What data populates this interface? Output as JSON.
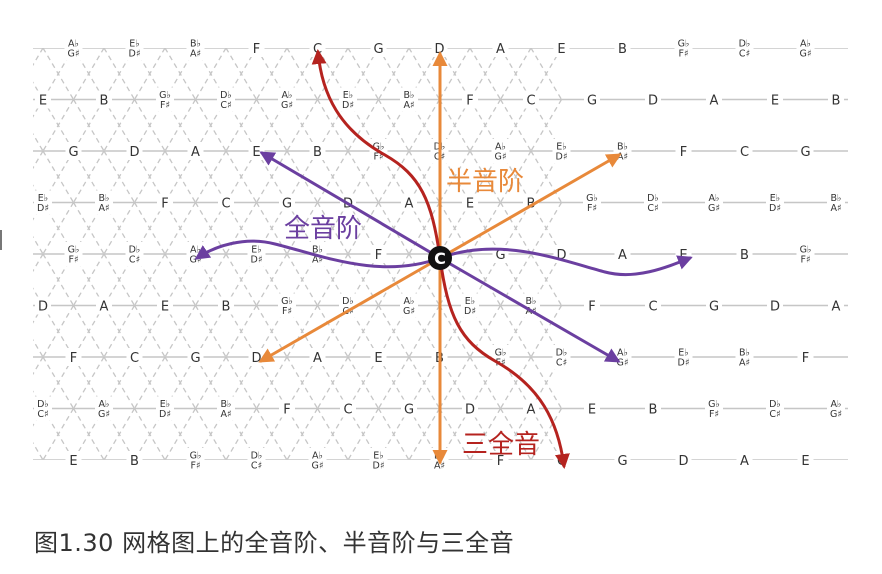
{
  "colors": {
    "semitone": "#E8893A",
    "whole_tone": "#6B3FA0",
    "tritone": "#B5231F",
    "grid": "#c6c6c6",
    "note_text": "#333333"
  },
  "grid": {
    "rows": [
      [
        "Ab|G#",
        "Eb|D#",
        "Bb|A#",
        "F",
        "C",
        "G",
        "D",
        "A",
        "E",
        "B",
        "Gb|F#",
        "Db|C#",
        "Ab|G#"
      ],
      [
        "E",
        "B",
        "Gb|F#",
        "Db|C#",
        "Ab|G#",
        "Eb|D#",
        "Bb|A#",
        "F",
        "C",
        "G",
        "D",
        "A",
        "E",
        "B"
      ],
      [
        "G",
        "D",
        "A",
        "E",
        "B",
        "Gb|F#",
        "Db|C#",
        "Ab|G#",
        "Eb|D#",
        "Bb|A#",
        "F",
        "C",
        "G"
      ],
      [
        "Eb|D#",
        "Bb|A#",
        "F",
        "C",
        "G",
        "D",
        "A",
        "E",
        "B",
        "Gb|F#",
        "Db|C#",
        "Ab|G#",
        "Eb|D#",
        "Bb|A#"
      ],
      [
        "Gb|F#",
        "Db|C#",
        "Ab|G#",
        "Eb|D#",
        "Bb|A#",
        "F",
        "C",
        "G",
        "D",
        "A",
        "E",
        "B",
        "Gb|F#"
      ],
      [
        "D",
        "A",
        "E",
        "B",
        "Gb|F#",
        "Db|C#",
        "Ab|G#",
        "Eb|D#",
        "Bb|A#",
        "F",
        "C",
        "G",
        "D",
        "A"
      ],
      [
        "F",
        "C",
        "G",
        "D",
        "A",
        "E",
        "B",
        "Gb|F#",
        "Db|C#",
        "Ab|G#",
        "Eb|D#",
        "Bb|A#",
        "F"
      ],
      [
        "Db|C#",
        "Ab|G#",
        "Eb|D#",
        "Bb|A#",
        "F",
        "C",
        "G",
        "D",
        "A",
        "E",
        "B",
        "Gb|F#",
        "Db|C#",
        "Ab|G#"
      ],
      [
        "E",
        "B",
        "Gb|F#",
        "Db|C#",
        "Ab|G#",
        "Eb|D#",
        "Bb|A#",
        "F",
        "C",
        "G",
        "D",
        "A",
        "E"
      ]
    ]
  },
  "center_note": "C",
  "labels": {
    "semitone": "半音阶",
    "whole_tone": "全音阶",
    "tritone": "三全音"
  },
  "caption": "图1.30 网格图上的全音阶、半音阶与三全音"
}
